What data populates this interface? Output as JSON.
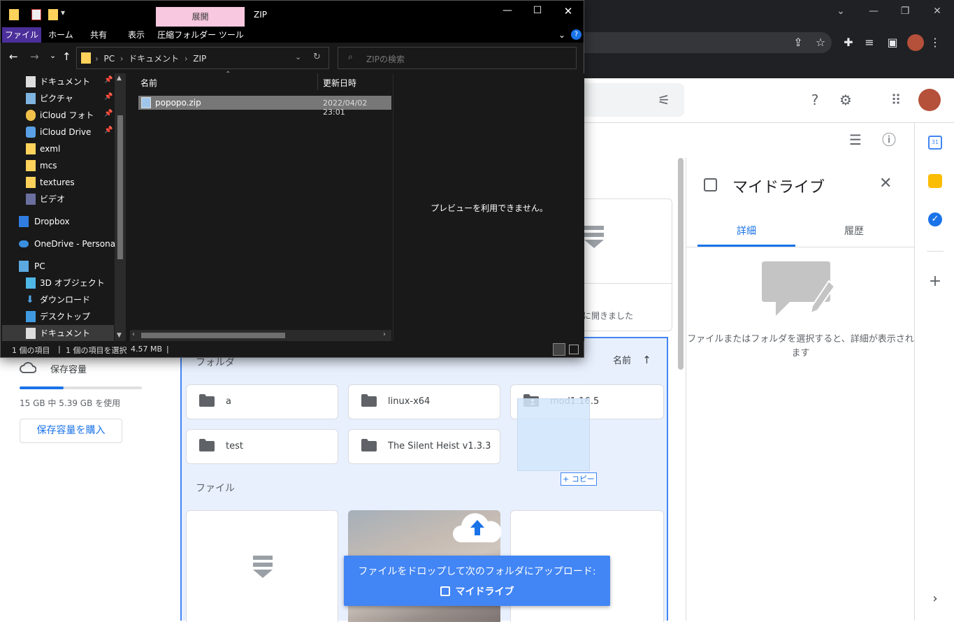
{
  "browser": {
    "window_controls": [
      "⌄",
      "—",
      "❐",
      "✕"
    ]
  },
  "drive": {
    "sidebar": {
      "storage_label": "保存容量",
      "storage_usage": "15 GB 中 5.39 GB を使用",
      "storage_fraction": 0.36,
      "buy_storage": "保存容量を購入"
    },
    "main": {
      "folders_label": "フォルダ",
      "sort_label": "名前",
      "files_label": "ファイル",
      "partial_text": "に開きました",
      "folders": [
        "a",
        "linux-x64",
        "mod1.16.5",
        "test",
        "The Silent Heist v1.3.3"
      ],
      "drag_copy_label": "+ コピー"
    },
    "details": {
      "title": "マイドライブ",
      "tab_details": "詳細",
      "tab_history": "履歴",
      "empty_message": "ファイルまたはフォルダを選択すると、詳細が表示されます"
    },
    "toast": {
      "line1": "ファイルをドロップして次のフォルダにアップロード:",
      "line2": "マイドライブ"
    }
  },
  "explorer": {
    "title_tab_expand": "展開",
    "title": "ZIP",
    "ribbon_tabs": [
      "ファイル",
      "ホーム",
      "共有",
      "表示",
      "圧縮フォルダー ツール"
    ],
    "breadcrumb": [
      "PC",
      "ドキュメント",
      "ZIP"
    ],
    "search_placeholder": "ZIPの検索",
    "nav_items": [
      "ドキュメント",
      "ピクチャ",
      "iCloud フォト",
      "iCloud Drive",
      "exml",
      "mcs",
      "textures",
      "ビデオ",
      "Dropbox",
      "OneDrive - Personal",
      "PC",
      "3D オブジェクト",
      "ダウンロード",
      "デスクトップ",
      "ドキュメント"
    ],
    "columns": {
      "name": "名前",
      "modified": "更新日時"
    },
    "files": [
      {
        "name": "popopo.zip",
        "modified": "2022/04/02 23:01"
      }
    ],
    "preview_message": "プレビューを利用できません。",
    "status": {
      "count": "1 個の項目",
      "selected": "1 個の項目を選択",
      "size": "4.57 MB"
    }
  }
}
